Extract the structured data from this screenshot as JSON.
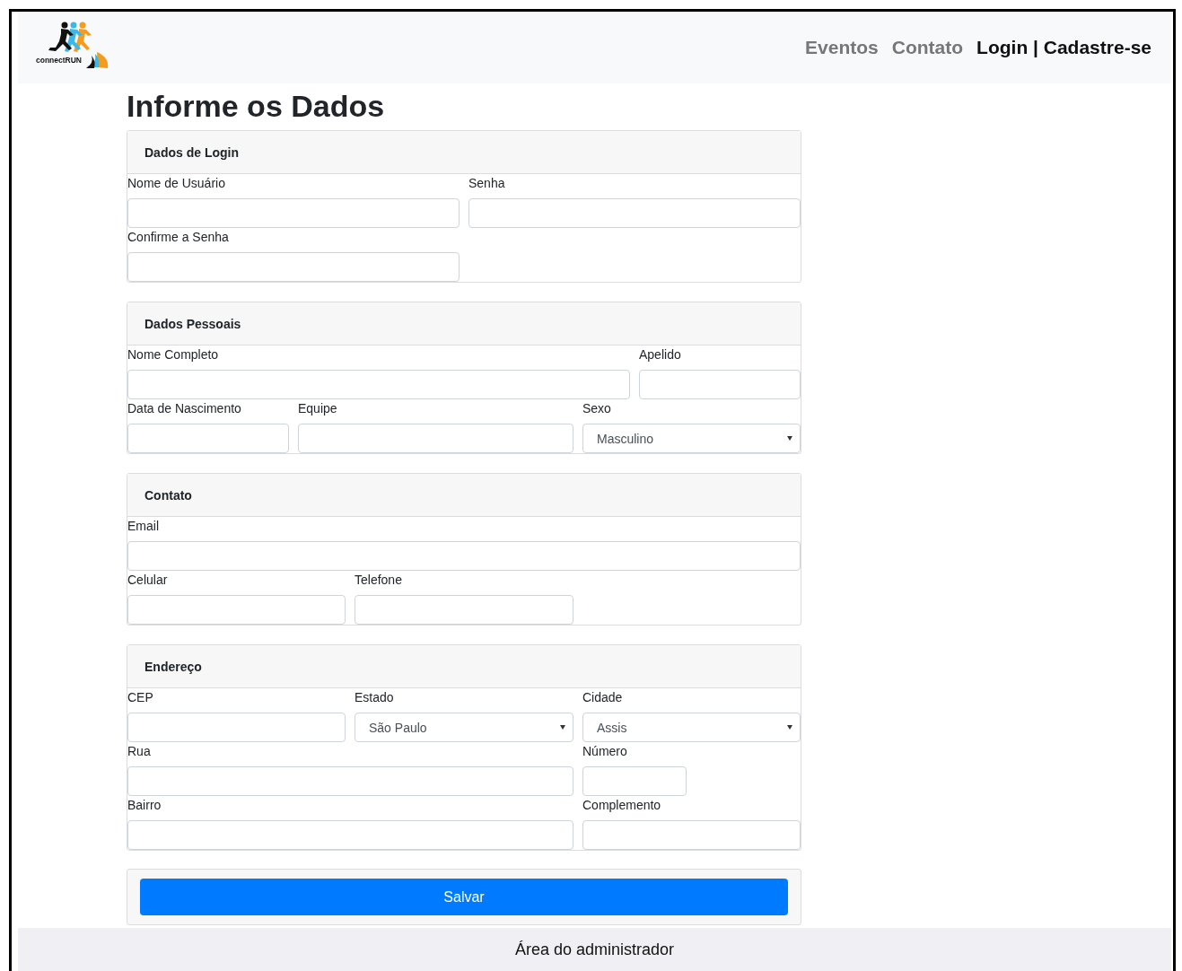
{
  "brand": {
    "name": "connectRUN"
  },
  "nav": [
    {
      "label": "Eventos",
      "selected": false
    },
    {
      "label": "Contato",
      "selected": false
    },
    {
      "label": "Login | Cadastre-se",
      "selected": true
    }
  ],
  "title": "Informe os Dados",
  "sections": [
    {
      "title": "Dados de Login",
      "rows": [
        [
          {
            "label": "Nome de Usuário",
            "kind": "text"
          },
          {
            "label": "Senha",
            "kind": "text"
          }
        ],
        [
          {
            "label": "Confirme a Senha",
            "kind": "text"
          }
        ]
      ]
    },
    {
      "title": "Dados Pessoais",
      "rows": [
        [
          {
            "label": "Nome Completo",
            "kind": "text"
          },
          {
            "label": "Apelido",
            "kind": "text"
          }
        ],
        [
          {
            "label": "Data de Nascimento",
            "kind": "text"
          },
          {
            "label": "Equipe",
            "kind": "text"
          },
          {
            "label": "Sexo",
            "kind": "select",
            "value": "Masculino"
          }
        ]
      ]
    },
    {
      "title": "Contato",
      "rows": [
        [
          {
            "label": "Email",
            "kind": "text"
          }
        ],
        [
          {
            "label": "Celular",
            "kind": "text"
          },
          {
            "label": "Telefone",
            "kind": "text"
          }
        ]
      ]
    },
    {
      "title": "Endereço",
      "rows": [
        [
          {
            "label": "CEP",
            "kind": "text"
          },
          {
            "label": "Estado",
            "kind": "select",
            "value": "São Paulo"
          },
          {
            "label": "Cidade",
            "kind": "select",
            "value": "Assis"
          }
        ],
        [
          {
            "label": "Rua",
            "kind": "text"
          },
          {
            "label": "Número",
            "kind": "text"
          }
        ],
        [
          {
            "label": "Bairro",
            "kind": "text"
          },
          {
            "label": "Complemento",
            "kind": "text"
          }
        ]
      ]
    }
  ],
  "submit": "Salvar",
  "footer": "Área do administrador"
}
